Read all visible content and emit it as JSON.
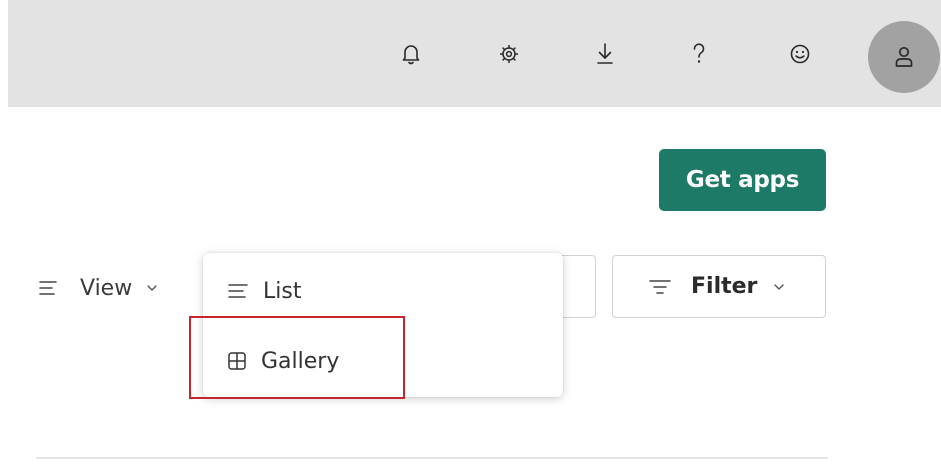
{
  "topbar": {
    "icons": [
      "bell-icon",
      "settings-gear-icon",
      "download-icon",
      "help-icon",
      "feedback-smiley-icon"
    ],
    "avatar_icon": "person-icon",
    "background": "#e3e3e3"
  },
  "actions": {
    "get_apps_label": "Get apps",
    "get_apps_color": "#1c7a66"
  },
  "toolbar": {
    "view_label": "View",
    "filter_label": "Filter"
  },
  "view_menu": {
    "items": [
      {
        "label": "List",
        "icon": "list-icon"
      },
      {
        "label": "Gallery",
        "icon": "gallery-grid-icon"
      }
    ],
    "highlighted_item": "Gallery",
    "highlight_color": "#c4262e"
  }
}
